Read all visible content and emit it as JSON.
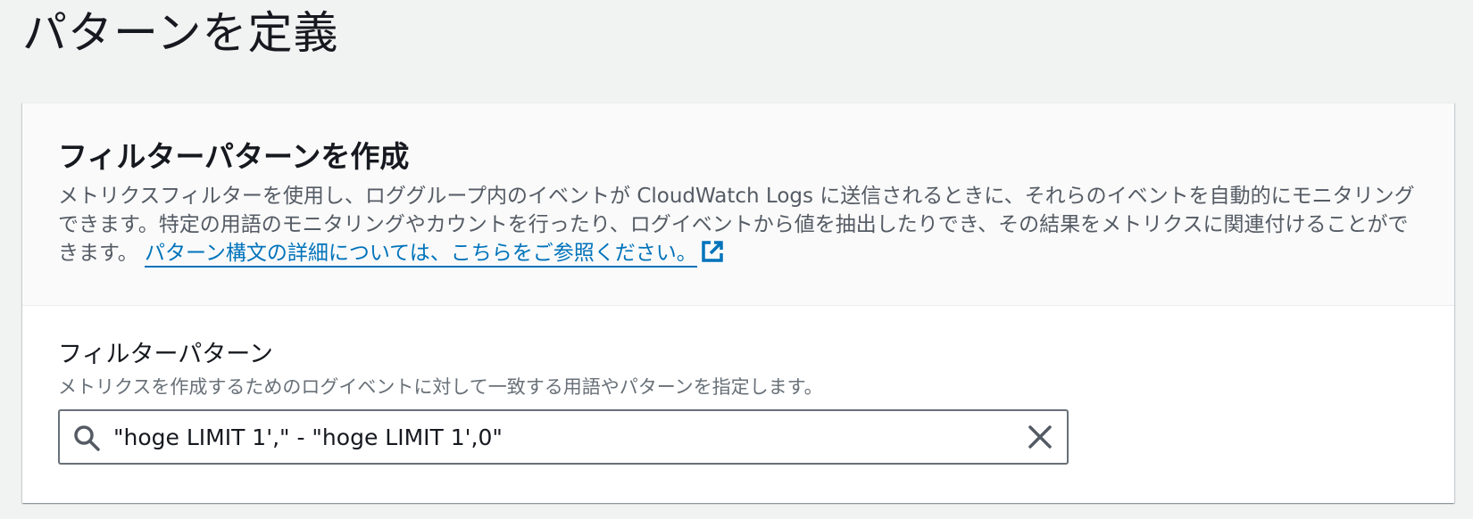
{
  "page": {
    "title": "パターンを定義"
  },
  "section": {
    "title": "フィルターパターンを作成",
    "description": "メトリクスフィルターを使用し、ロググループ内のイベントが CloudWatch Logs に送信されるときに、それらのイベントを自動的にモニタリングできます。特定の用語のモニタリングやカウントを行ったり、ログイベントから値を抽出したりでき、その結果をメトリクスに関連付けることができます。",
    "info_link": "パターン構文の詳細については、こちらをご参照ください。"
  },
  "filter_pattern": {
    "label": "フィルターパターン",
    "description": "メトリクスを作成するためのログイベントに対して一致する用語やパターンを指定します。",
    "value": "\"hoge LIMIT 1',\" - \"hoge LIMIT 1',0\""
  },
  "icons": {
    "external_link": "external-link-icon",
    "search": "search-icon",
    "clear": "close-icon"
  },
  "colors": {
    "link": "#0073bb",
    "text": "#16191f",
    "secondary_text": "#545b64",
    "page_background": "#f1f2f2"
  }
}
